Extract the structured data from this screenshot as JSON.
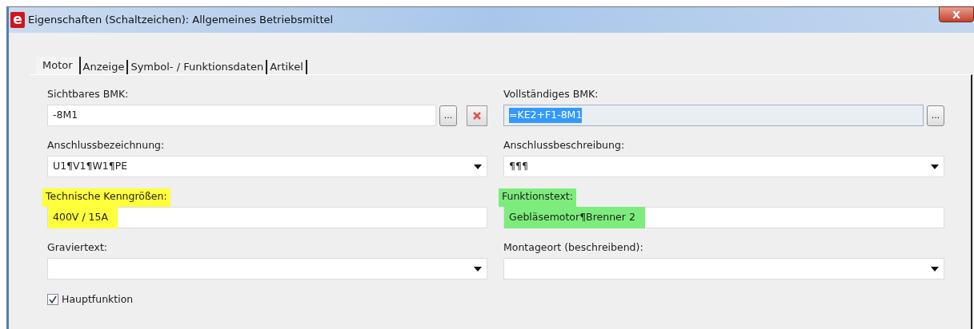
{
  "window": {
    "app_icon": "e",
    "title": "Eigenschaften (Schaltzeichen): Allgemeines Betriebsmittel",
    "close": "X"
  },
  "tabs": [
    {
      "label": "Motor",
      "selected": true
    },
    {
      "label": "Anzeige",
      "selected": false
    },
    {
      "label": "Symbol- / Funktionsdaten",
      "selected": false
    },
    {
      "label": "Artikel",
      "selected": false
    }
  ],
  "rows": [
    {
      "cells": [
        {
          "kind": "text",
          "label": "Sichtbares BMK:",
          "value": "-8M1",
          "browse": "...",
          "delete": true
        },
        {
          "kind": "text",
          "label": "Vollständiges BMK:",
          "value": "=KE2+F1-8M1",
          "readonly": true,
          "text_selected": true,
          "browse": "..."
        }
      ]
    },
    {
      "cells": [
        {
          "kind": "combo",
          "label": "Anschlussbezeichnung:",
          "value": "U1¶V1¶W1¶PE"
        },
        {
          "kind": "combo",
          "label": "Anschlussbeschreibung:",
          "value": "¶¶¶"
        }
      ]
    },
    {
      "cells": [
        {
          "kind": "text",
          "label": "Technische Kenngrößen:",
          "value": "400V / 15A",
          "color": "#ffff3c"
        },
        {
          "kind": "text",
          "label": "Funktionstext:",
          "value": "Gebläsemotor¶Brenner 2",
          "color": "#7ced7c"
        }
      ]
    },
    {
      "cells": [
        {
          "kind": "combo",
          "label": "Graviertext:"
        },
        {
          "kind": "combo",
          "label": "Montageort (beschreibend):"
        }
      ]
    }
  ],
  "checkbox": {
    "label": "Hauptfunktion",
    "checked": true
  }
}
